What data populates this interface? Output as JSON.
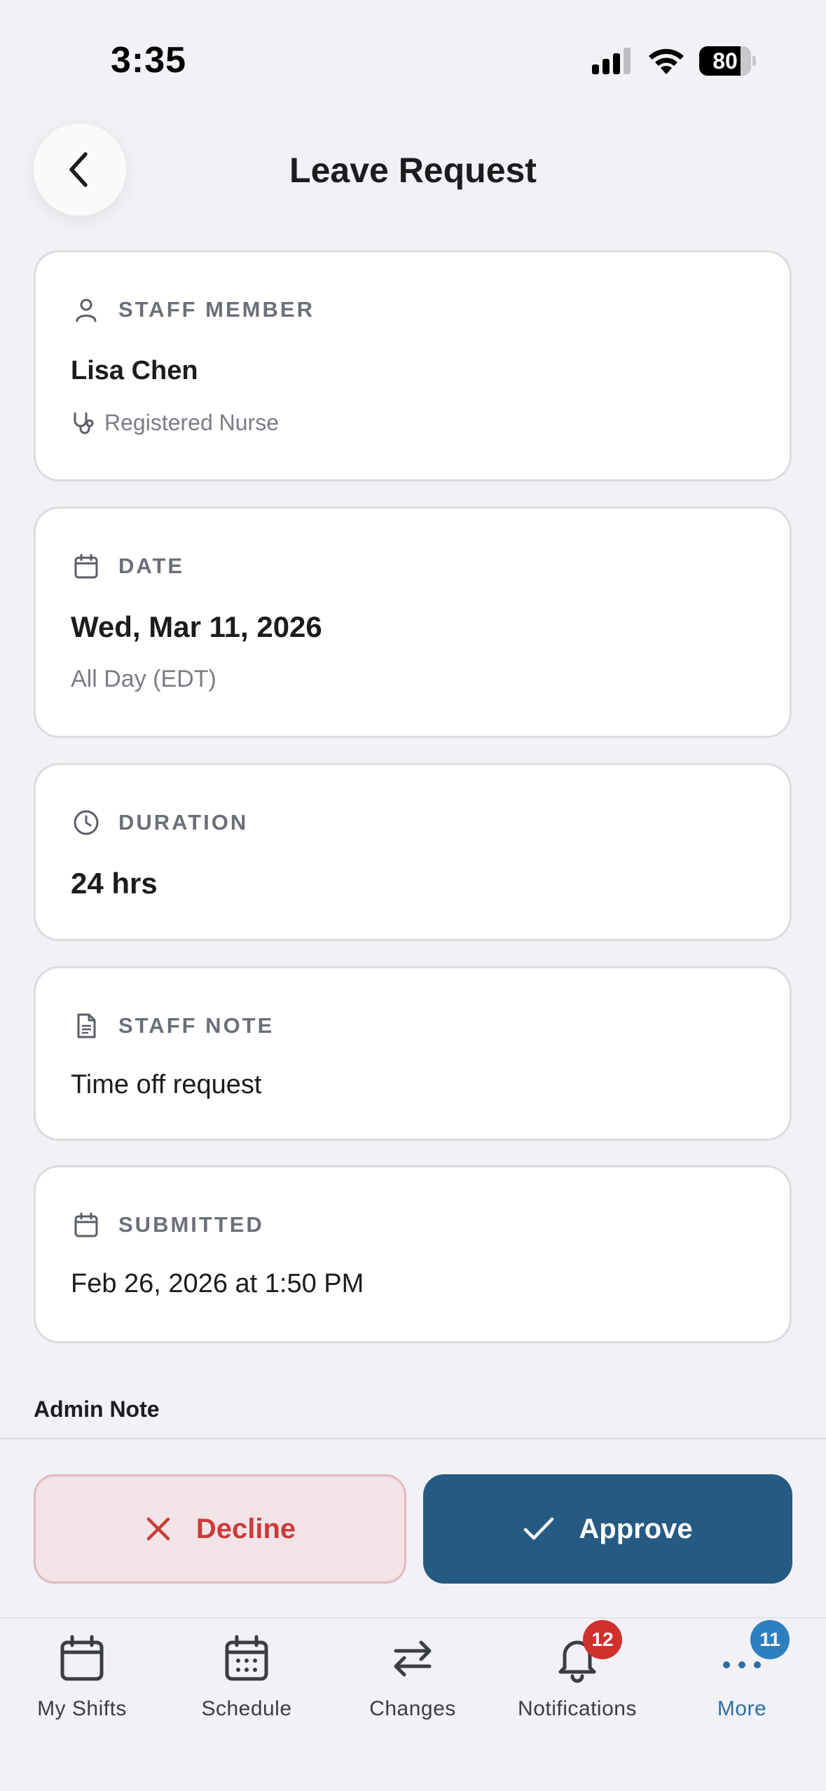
{
  "status_bar": {
    "time": "3:35",
    "battery": "80",
    "battery_level": 0.8
  },
  "header": {
    "title": "Leave Request",
    "back_icon": "chevron-left-icon"
  },
  "cards": {
    "staff": {
      "label": "STAFF MEMBER",
      "icon": "person-icon",
      "name": "Lisa Chen",
      "role": "Registered Nurse",
      "role_icon": "stethoscope-icon"
    },
    "date": {
      "label": "DATE",
      "icon": "calendar-icon",
      "value": "Wed, Mar 11, 2026",
      "sub": "All Day (EDT)"
    },
    "duration": {
      "label": "DURATION",
      "icon": "clock-icon",
      "value": "24 hrs"
    },
    "note": {
      "label": "STAFF NOTE",
      "icon": "document-icon",
      "value": "Time off request"
    },
    "submitted": {
      "label": "SUBMITTED",
      "icon": "calendar-icon",
      "value": "Feb 26, 2026 at 1:50 PM"
    }
  },
  "admin_note": {
    "label": "Admin Note"
  },
  "actions": {
    "decline": {
      "label": "Decline",
      "icon": "x-icon"
    },
    "approve": {
      "label": "Approve",
      "icon": "check-icon"
    }
  },
  "tabs": [
    {
      "label": "My Shifts",
      "icon": "calendar-icon"
    },
    {
      "label": "Schedule",
      "icon": "calendar-grid-icon"
    },
    {
      "label": "Changes",
      "icon": "swap-arrows-icon"
    },
    {
      "label": "Notifications",
      "icon": "bell-icon",
      "badge": "12"
    },
    {
      "label": "More",
      "icon": "more-dots-icon",
      "badge": "11",
      "active": true
    }
  ],
  "colors": {
    "accent": "#255a82",
    "decline": "#c93c3c",
    "badge_red": "#d0312d",
    "badge_blue": "#2e7fc0"
  }
}
